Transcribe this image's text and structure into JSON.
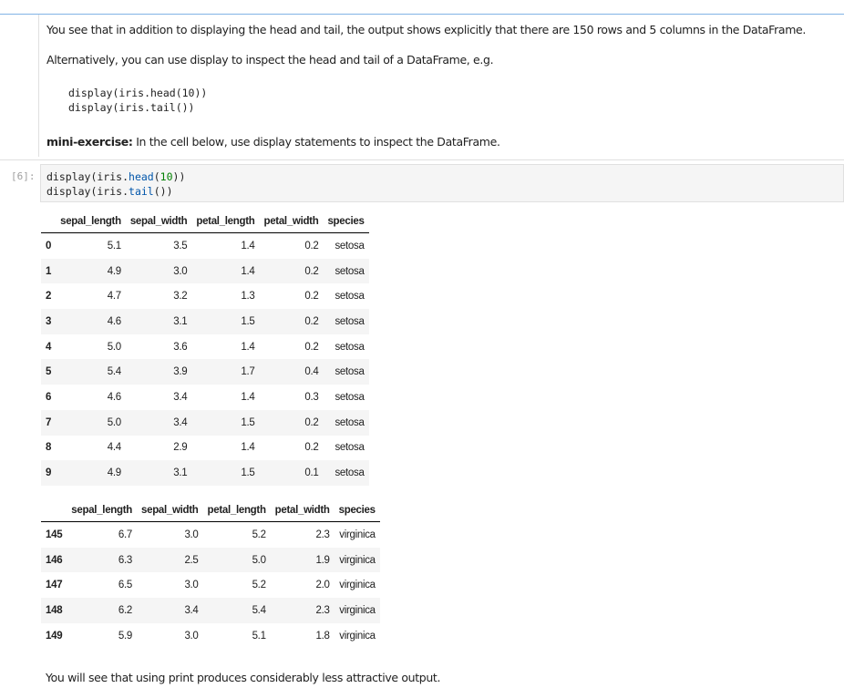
{
  "markdown": {
    "para1": "You see that in addition to displaying the head and tail, the output shows explicitly that there are 150 rows and 5 columns in the DataFrame.",
    "para2": "Alternatively, you can use display to inspect the head and tail of a DataFrame, e.g.",
    "code_line1": "display(iris.head(10))",
    "code_line2": "display(iris.tail())",
    "exercise_label": "mini-exercise:",
    "exercise_text": " In the cell below, use display statements to inspect the DataFrame."
  },
  "code_cell": {
    "prompt": "[6]:",
    "line1": {
      "a": "display(iris.",
      "fn": "head",
      "b": "(",
      "num": "10",
      "c": "))"
    },
    "line2": {
      "a": "display(iris.",
      "fn": "tail",
      "c": "())"
    }
  },
  "table_head": {
    "columns": [
      "",
      "sepal_length",
      "sepal_width",
      "petal_length",
      "petal_width",
      "species"
    ],
    "rows": [
      [
        "0",
        "5.1",
        "3.5",
        "1.4",
        "0.2",
        "setosa"
      ],
      [
        "1",
        "4.9",
        "3.0",
        "1.4",
        "0.2",
        "setosa"
      ],
      [
        "2",
        "4.7",
        "3.2",
        "1.3",
        "0.2",
        "setosa"
      ],
      [
        "3",
        "4.6",
        "3.1",
        "1.5",
        "0.2",
        "setosa"
      ],
      [
        "4",
        "5.0",
        "3.6",
        "1.4",
        "0.2",
        "setosa"
      ],
      [
        "5",
        "5.4",
        "3.9",
        "1.7",
        "0.4",
        "setosa"
      ],
      [
        "6",
        "4.6",
        "3.4",
        "1.4",
        "0.3",
        "setosa"
      ],
      [
        "7",
        "5.0",
        "3.4",
        "1.5",
        "0.2",
        "setosa"
      ],
      [
        "8",
        "4.4",
        "2.9",
        "1.4",
        "0.2",
        "setosa"
      ],
      [
        "9",
        "4.9",
        "3.1",
        "1.5",
        "0.1",
        "setosa"
      ]
    ]
  },
  "table_tail": {
    "columns": [
      "",
      "sepal_length",
      "sepal_width",
      "petal_length",
      "petal_width",
      "species"
    ],
    "rows": [
      [
        "145",
        "6.7",
        "3.0",
        "5.2",
        "2.3",
        "virginica"
      ],
      [
        "146",
        "6.3",
        "2.5",
        "5.0",
        "1.9",
        "virginica"
      ],
      [
        "147",
        "6.5",
        "3.0",
        "5.2",
        "2.0",
        "virginica"
      ],
      [
        "148",
        "6.2",
        "3.4",
        "5.4",
        "2.3",
        "virginica"
      ],
      [
        "149",
        "5.9",
        "3.0",
        "5.1",
        "1.8",
        "virginica"
      ]
    ]
  },
  "bottom_text": "You will see that using print produces considerably less attractive output."
}
